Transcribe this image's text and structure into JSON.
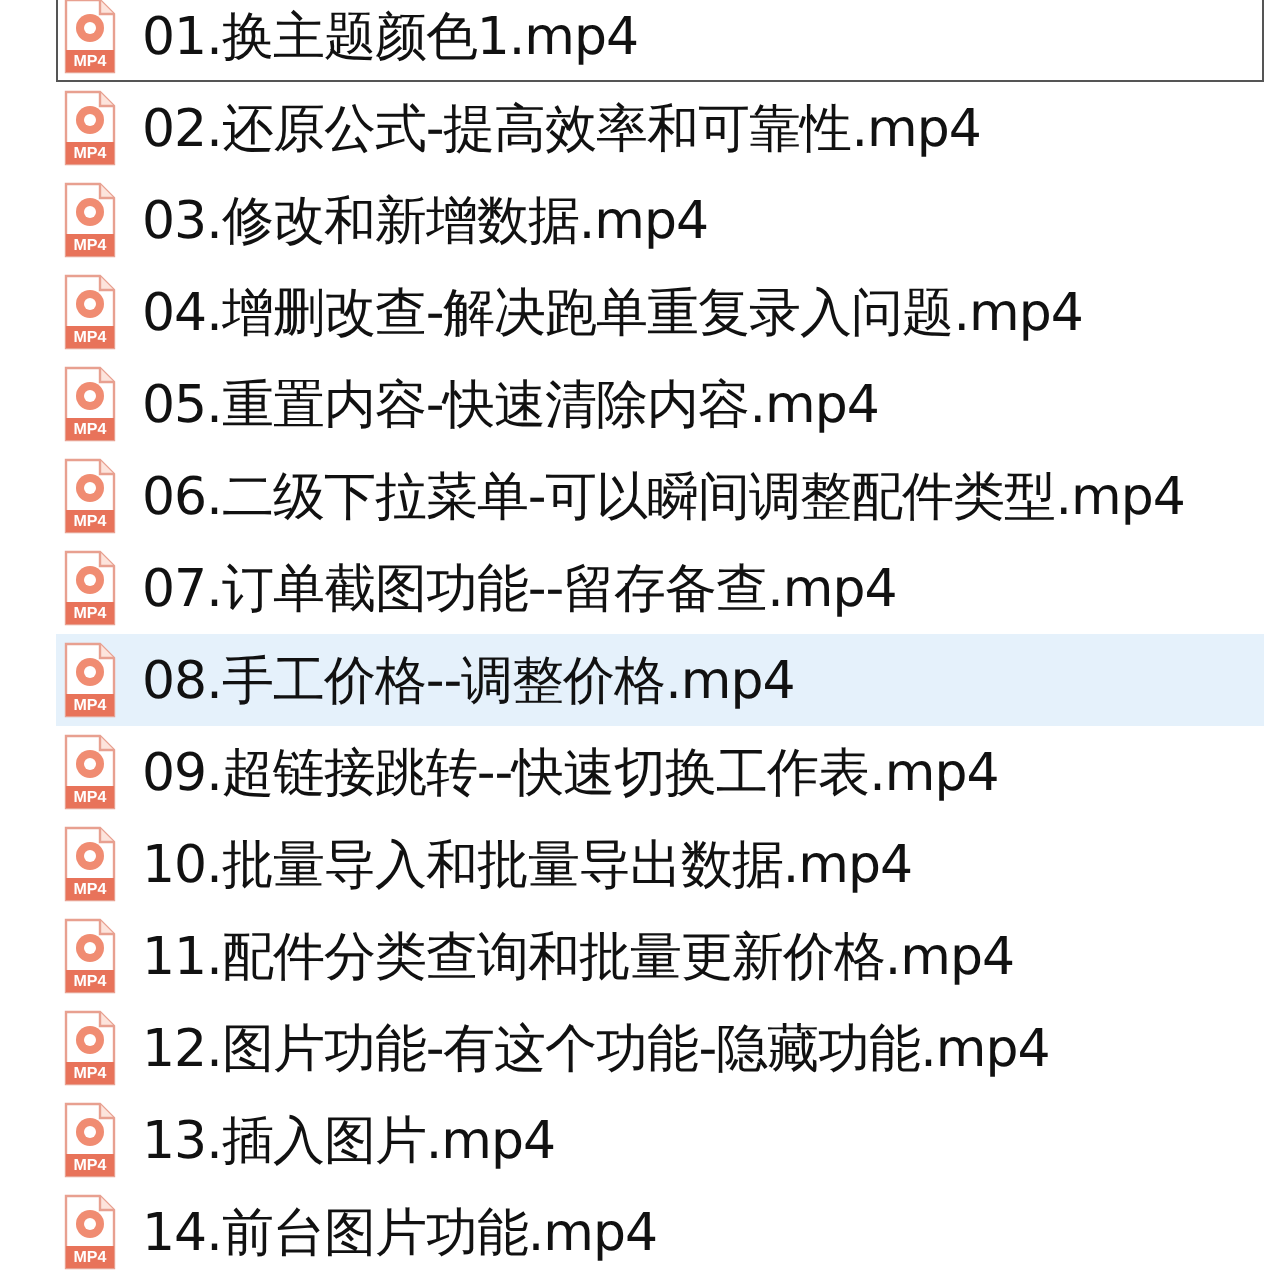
{
  "files": [
    {
      "name": "01.换主题颜色1.mp4",
      "icon_label": "MP4",
      "focused": true,
      "highlighted": false
    },
    {
      "name": "02.还原公式-提高效率和可靠性.mp4",
      "icon_label": "MP4",
      "focused": false,
      "highlighted": false
    },
    {
      "name": "03.修改和新增数据.mp4",
      "icon_label": "MP4",
      "focused": false,
      "highlighted": false
    },
    {
      "name": "04.增删改查-解决跑单重复录入问题.mp4",
      "icon_label": "MP4",
      "focused": false,
      "highlighted": false
    },
    {
      "name": "05.重置内容-快速清除内容.mp4",
      "icon_label": "MP4",
      "focused": false,
      "highlighted": false
    },
    {
      "name": "06.二级下拉菜单-可以瞬间调整配件类型.mp4",
      "icon_label": "MP4",
      "focused": false,
      "highlighted": false
    },
    {
      "name": "07.订单截图功能--留存备查.mp4",
      "icon_label": "MP4",
      "focused": false,
      "highlighted": false
    },
    {
      "name": "08.手工价格--调整价格.mp4",
      "icon_label": "MP4",
      "focused": false,
      "highlighted": true
    },
    {
      "name": "09.超链接跳转--快速切换工作表.mp4",
      "icon_label": "MP4",
      "focused": false,
      "highlighted": false
    },
    {
      "name": "10.批量导入和批量导出数据.mp4",
      "icon_label": "MP4",
      "focused": false,
      "highlighted": false
    },
    {
      "name": "11.配件分类查询和批量更新价格.mp4",
      "icon_label": "MP4",
      "focused": false,
      "highlighted": false
    },
    {
      "name": "12.图片功能-有这个功能-隐藏功能.mp4",
      "icon_label": "MP4",
      "focused": false,
      "highlighted": false
    },
    {
      "name": "13.插入图片.mp4",
      "icon_label": "MP4",
      "focused": false,
      "highlighted": false
    },
    {
      "name": "14.前台图片功能.mp4",
      "icon_label": "MP4",
      "focused": false,
      "highlighted": false
    }
  ]
}
